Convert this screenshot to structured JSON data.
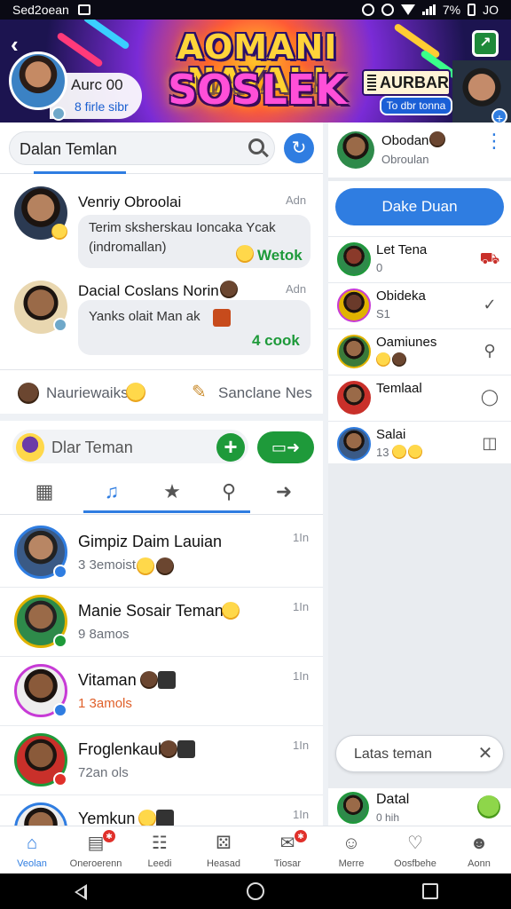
{
  "status_bar": {
    "carrier": "Sed2oean",
    "battery": "7%",
    "time": "JO"
  },
  "banner": {
    "title_line1": "AOMANI NAYAL!",
    "title_line2": "SOSLEK",
    "profile": {
      "name": "Aurc 00",
      "sub": "8 firle sibr"
    },
    "promo": {
      "label": "AURBAR",
      "button": "To dbr tonna"
    }
  },
  "search": {
    "placeholder": "Dalan Temlan"
  },
  "posts": [
    {
      "name": "Venriy Obroolai",
      "time": "Adn",
      "text": "Terim sksherskau Ioncaka Ycak (indromallan)",
      "action": "Wetok"
    },
    {
      "name": "Dacial Coslans Norin",
      "time": "Adn",
      "text": "Yanks olait Man ak",
      "action": "4 cook"
    }
  ],
  "reactions": {
    "left": "Nauriewaiks",
    "right": "Sanclane Nes"
  },
  "compose": {
    "placeholder": "Dlar Teman"
  },
  "tabs": [
    {
      "icon": "image-icon"
    },
    {
      "icon": "music-icon"
    },
    {
      "icon": "star-icon"
    },
    {
      "icon": "search-icon"
    },
    {
      "icon": "share-icon"
    }
  ],
  "friends": [
    {
      "name": "Gimpiz Daim Lauian",
      "sub": "3 3emoist",
      "time": "1In",
      "ring": "#2f7de1",
      "badge": "#2f7de1"
    },
    {
      "name": "Manie Sosair Teman",
      "sub": "9 8amos",
      "time": "1In",
      "ring": "#e0b300",
      "badge": "#1e9a3a"
    },
    {
      "name": "Vitaman",
      "sub": "1 3amols",
      "time": "1In",
      "ring": "#c73bd6",
      "badge": "#2f7de1",
      "sub_color": "#e0602a"
    },
    {
      "name": "Froglenkaull",
      "sub": "72an ols",
      "time": "1In",
      "ring": "#1e9a3a",
      "badge": "#e0302a"
    },
    {
      "name": "Yemkun",
      "sub": "",
      "time": "1In",
      "ring": "#2f7de1",
      "badge": "#2f7de1"
    }
  ],
  "right_panel": {
    "header": {
      "name": "Obodan",
      "sub": "Obroulan"
    },
    "button": "Dake Duan",
    "items": [
      {
        "name": "Let Tena",
        "sub": "0",
        "icon": "truck-icon"
      },
      {
        "name": "Obideka",
        "sub": "S1",
        "icon": "check-circle-icon"
      },
      {
        "name": "Oamiunes",
        "sub": "",
        "icon": "chat-bubble-icon"
      },
      {
        "name": "Temlaal",
        "sub": "",
        "icon": "chat-bubble-icon"
      },
      {
        "name": "Salai",
        "sub": "13",
        "icon": "door-icon"
      }
    ],
    "toast": "Latas teman",
    "bottom": {
      "name": "Datal",
      "sub": "0 hih"
    }
  },
  "bottom_nav": [
    {
      "label": "Veolan",
      "icon": "home-icon",
      "active": true
    },
    {
      "label": "Oneroerenn",
      "icon": "chart-icon",
      "dot": true
    },
    {
      "label": "Leedi",
      "icon": "list-icon"
    },
    {
      "label": "Heasad",
      "icon": "game-icon"
    },
    {
      "label": "Tiosar",
      "icon": "inbox-icon",
      "dot": true
    },
    {
      "label": "Merre",
      "icon": "person-icon"
    },
    {
      "label": "Oosfbehe",
      "icon": "heart-icon"
    },
    {
      "label": "Aonn",
      "icon": "profile-icon"
    }
  ]
}
